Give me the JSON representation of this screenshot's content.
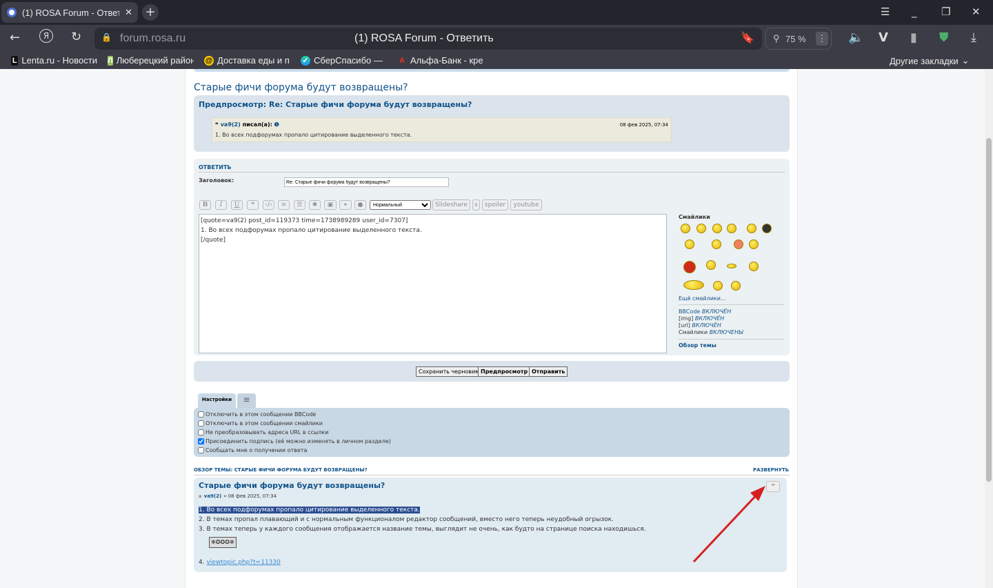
{
  "browser": {
    "tab_title": "(1) ROSA Forum - Ответить",
    "url": "forum.rosa.ru",
    "page_title": "(1) ROSA Forum - Ответить",
    "zoom": "75 %",
    "bookmarks": [
      "Lenta.ru - Новости",
      "Люберецкий район",
      "Доставка еды и п",
      "СберСпасибо — ",
      "Альфа-Банк - кре"
    ],
    "other_bookmarks": "Другие закладки"
  },
  "topic_title": "Старые фичи форума будут возвращены?",
  "preview": {
    "heading": "Предпросмотр: Re: Старые фичи форума будут возвращены?",
    "quote_author": "va9(2)",
    "quote_wrote": "писал(а):",
    "quote_date": "08 фев 2025, 07:34",
    "quote_text": "1. Во всех подфорумах пропало цитирование выделенного текста."
  },
  "reply": {
    "heading": "ОТВЕТИТЬ",
    "subject_label": "Заголовок:",
    "subject_value": "Re: Старые фичи форума будут возвращены?",
    "font_size": "Нормальный",
    "extra_buttons": [
      "Slideshare",
      "s",
      "spoiler",
      "youtube"
    ],
    "message_lines": [
      "[quote=va9(2) post_id=119373 time=1738989289 user_id=7307]",
      "1. Во всех подфорумах пропало цитирование выделенного текста.",
      "[/quote]"
    ],
    "smilies_title": "Смайлики",
    "more_smilies": "Ещё смайлики...",
    "status": [
      {
        "k": "BBCode",
        "v": "ВКЛЮЧЁН"
      },
      {
        "k": "[img]",
        "v": "ВКЛЮЧЁН"
      },
      {
        "k": "[url]",
        "v": "ВКЛЮЧЁН"
      },
      {
        "k": "Смайлики",
        "v": "ВКЛЮЧЕНЫ"
      }
    ],
    "topic_review_link": "Обзор темы",
    "save_draft": "Сохранить черновик",
    "preview": "Предпросмотр",
    "submit": "Отправить"
  },
  "options": {
    "tab": "Настройки",
    "items": [
      {
        "label": "Отключить в этом сообщении BBCode",
        "checked": false
      },
      {
        "label": "Отключить в этом сообщении смайлики",
        "checked": false
      },
      {
        "label": "Не преобразовывать адреса URL в ссылки",
        "checked": false
      },
      {
        "label": "Присоединить подпись (её можно изменять в личном разделе)",
        "checked": true
      },
      {
        "label": "Сообщать мне о получении ответа",
        "checked": false
      }
    ]
  },
  "review": {
    "heading": "ОБЗОР ТЕМЫ: СТАРЫЕ ФИЧИ ФОРУМА БУДУТ ВОЗВРАЩЕНЫ?",
    "expand": "РАЗВЕРНУТЬ",
    "post_title": "Старые фичи форума будут возвращены?",
    "author": "va9(2)",
    "date": "» 08 фев 2025, 07:34",
    "lines": [
      "1. Во всех подфорумах пропало цитирование выделенного текста.",
      "2. В темах пропал плавающий и с нормальным функционалом редактор сообщений, вместо него теперь неудобный огрызок.",
      "3. В темах теперь у каждого сообщения отображается название темы, выглядит не очень, как будто на странице поиска находишься."
    ],
    "sig": "✻✪✪✪✻",
    "line4_prefix": "4.",
    "line4_link": "viewtopic.php?t=11330"
  }
}
